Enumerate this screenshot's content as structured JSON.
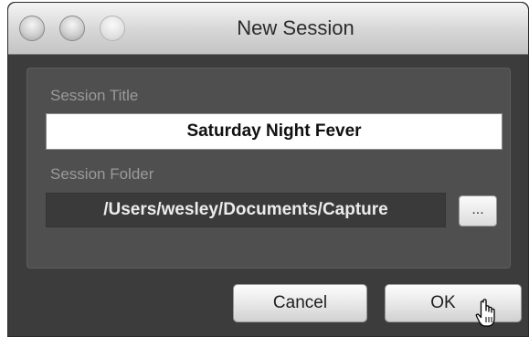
{
  "window": {
    "title": "New Session"
  },
  "form": {
    "session_title_label": "Session Title",
    "session_title_value": "Saturday Night Fever",
    "session_folder_label": "Session Folder",
    "session_folder_value": "/Users/wesley/Documents/Capture",
    "browse_label": "..."
  },
  "buttons": {
    "cancel_label": "Cancel",
    "ok_label": "OK"
  },
  "icons": {
    "close": "close-icon",
    "minimize": "minimize-icon",
    "zoom": "zoom-icon",
    "cursor": "hand-pointer-icon"
  }
}
